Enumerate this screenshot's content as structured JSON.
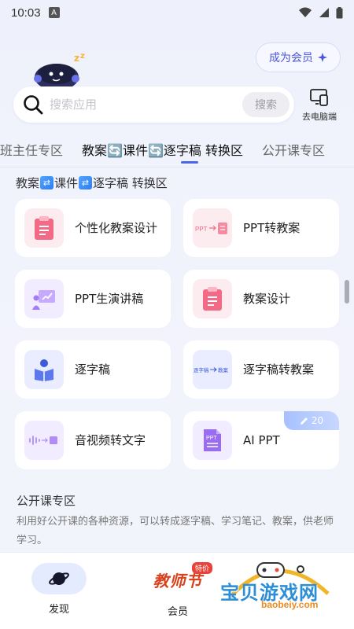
{
  "status_bar": {
    "time": "10:03",
    "badge": "A"
  },
  "header": {
    "vip_label": "成为会员"
  },
  "search": {
    "placeholder": "搜索应用",
    "button_label": "搜索",
    "pc_label": "去电脑端"
  },
  "tabs": [
    {
      "label": "班主任专区"
    },
    {
      "label": "教案🔄课件🔄逐字稿 转换区"
    },
    {
      "label": "公开课专区"
    }
  ],
  "section": {
    "title_parts": [
      "教案",
      "课件",
      "逐字稿 转换区"
    ]
  },
  "cards": [
    {
      "label": "个性化教案设计",
      "icon": "clipboard-icon"
    },
    {
      "label": "PPT转教案",
      "icon": "ppt-to-doc-icon",
      "icon_text": "PPT"
    },
    {
      "label": "PPT生演讲稿",
      "icon": "presentation-icon"
    },
    {
      "label": "教案设计",
      "icon": "clipboard-icon"
    },
    {
      "label": "逐字稿",
      "icon": "book-reader-icon"
    },
    {
      "label": "逐字稿转教案",
      "icon": "transcript-to-plan-icon",
      "icon_text_a": "逐字稿",
      "icon_text_b": "教案"
    },
    {
      "label": "音视频转文字",
      "icon": "audio-wave-icon"
    },
    {
      "label": "AI PPT",
      "icon": "ppt-file-icon",
      "icon_text": "PPT",
      "badge": "20"
    }
  ],
  "public_course": {
    "title": "公开课专区",
    "description": "利用好公开课的各种资源，可以转成逐字稿、学习笔记、教案，供老师学习。"
  },
  "bottom_nav": {
    "discover_label": "发现",
    "member_label": "会员",
    "promo_word": "教师节",
    "promo_tag": "特价"
  },
  "watermark": {
    "text": "宝贝游戏网",
    "url": "baobeiy.com"
  },
  "colors": {
    "accent": "#4a65e8",
    "card_bg": "#ffffff",
    "page_bg": "#eef0fb",
    "promo_red": "#d9411c"
  }
}
